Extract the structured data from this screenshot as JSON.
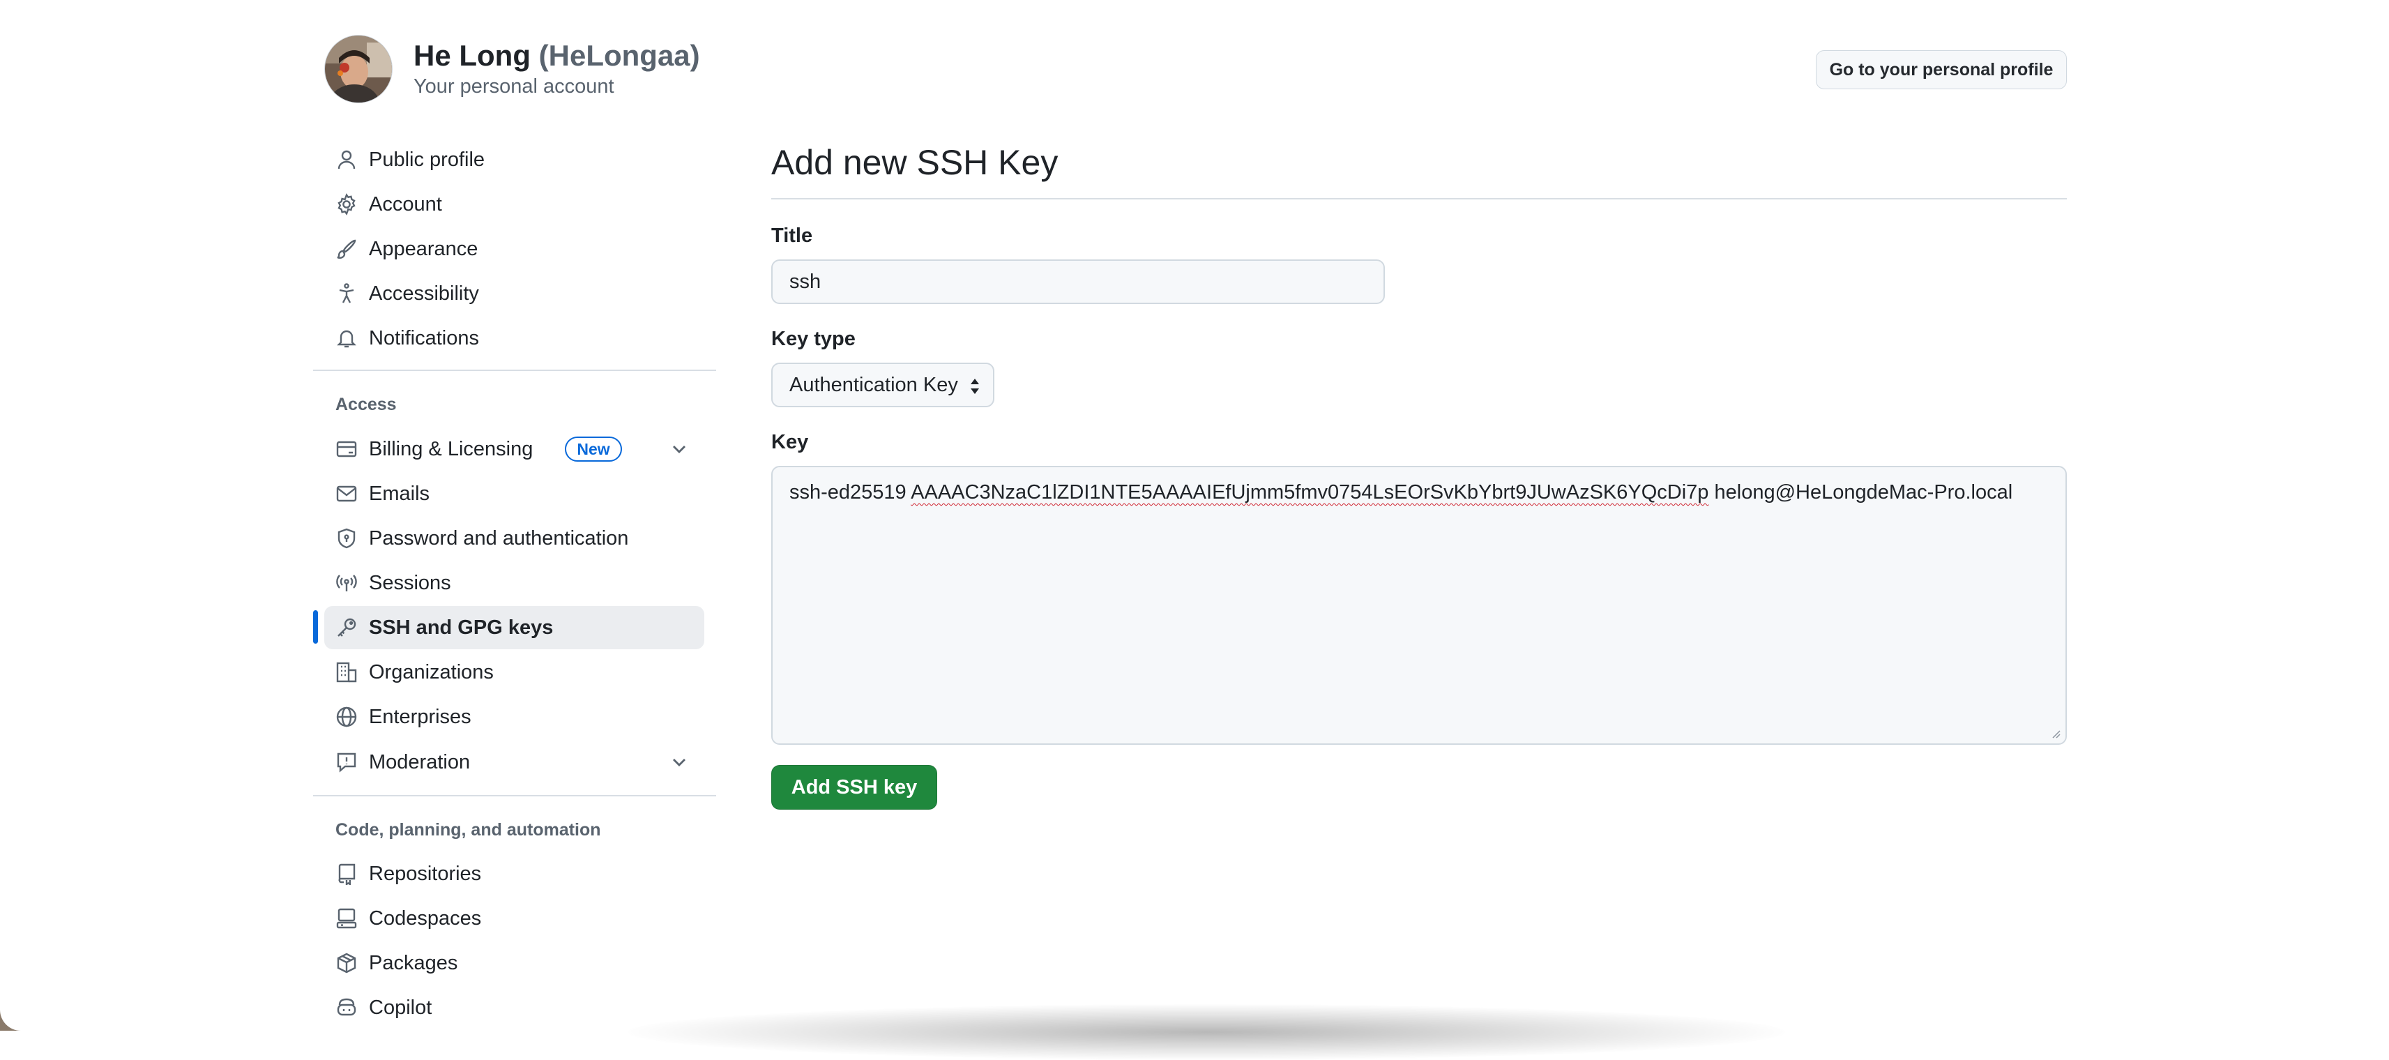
{
  "header": {
    "display_name": "He Long",
    "login": "(HeLongaa)",
    "subtitle": "Your personal account",
    "profile_button": "Go to your personal profile"
  },
  "sidebar": {
    "items_top": [
      {
        "label": "Public profile",
        "icon": "person-icon"
      },
      {
        "label": "Account",
        "icon": "gear-icon"
      },
      {
        "label": "Appearance",
        "icon": "paintbrush-icon"
      },
      {
        "label": "Accessibility",
        "icon": "accessibility-icon"
      },
      {
        "label": "Notifications",
        "icon": "bell-icon"
      }
    ],
    "access_label": "Access",
    "items_access": [
      {
        "label": "Billing & Licensing",
        "icon": "credit-card-icon",
        "badge": "New"
      },
      {
        "label": "Emails",
        "icon": "mail-icon"
      },
      {
        "label": "Password and authentication",
        "icon": "shield-lock-icon"
      },
      {
        "label": "Sessions",
        "icon": "broadcast-icon"
      },
      {
        "label": "SSH and GPG keys",
        "icon": "key-icon",
        "active": true
      },
      {
        "label": "Organizations",
        "icon": "organization-icon"
      },
      {
        "label": "Enterprises",
        "icon": "globe-icon"
      },
      {
        "label": "Moderation",
        "icon": "report-icon"
      }
    ],
    "code_label": "Code, planning, and automation",
    "items_code": [
      {
        "label": "Repositories",
        "icon": "repo-icon"
      },
      {
        "label": "Codespaces",
        "icon": "codespaces-icon"
      },
      {
        "label": "Packages",
        "icon": "package-icon"
      },
      {
        "label": "Copilot",
        "icon": "copilot-icon"
      }
    ]
  },
  "main": {
    "heading": "Add new SSH Key",
    "title_label": "Title",
    "title_value": "ssh",
    "keytype_label": "Key type",
    "keytype_value": "Authentication Key",
    "key_label": "Key",
    "key_prefix": "ssh-ed25519",
    "key_body": "AAAAC3NzaC1lZDI1NTE5AAAAIEfUjmm5fmv0754LsEOrSvKbYbrt9JUwAzSK6YQcDi7p",
    "key_comment": "helong@HeLongdeMac-Pro.local",
    "submit_button": "Add SSH key"
  },
  "colors": {
    "accent": "#0969da",
    "primary_button": "#1f883d",
    "active_nav_bg": "#ebedf0"
  }
}
